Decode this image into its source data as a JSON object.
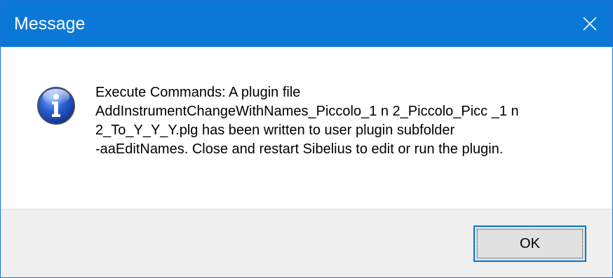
{
  "window": {
    "title": "Message",
    "close_icon": "close-icon",
    "accent_color": "#0a78d7"
  },
  "dialog": {
    "icon": "information-icon",
    "message": "Execute Commands:  A plugin file\nAddInstrumentChangeWithNames_Piccolo_1 n 2_Piccolo_Picc _1 n\n2_To_Y_Y_Y.plg has been written to user plugin subfolder\n-aaEditNames. Close and restart Sibelius to edit or run the plugin."
  },
  "buttons": {
    "ok_label": "OK"
  }
}
